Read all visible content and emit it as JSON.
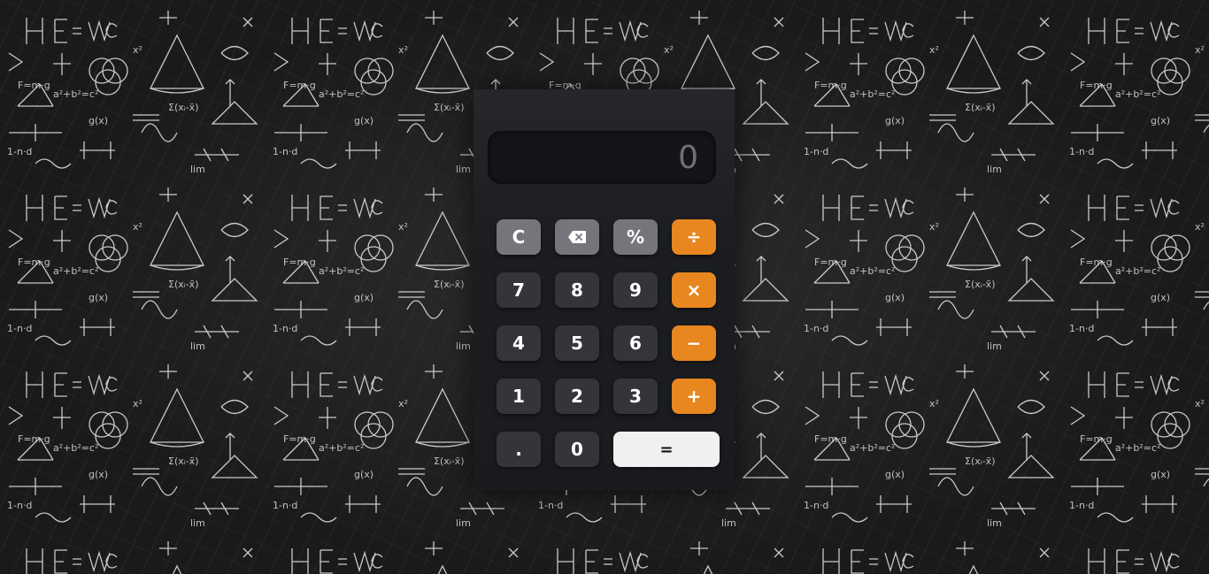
{
  "display": {
    "value": "0"
  },
  "keys": {
    "clear": "C",
    "percent": "%",
    "divide": "÷",
    "seven": "7",
    "eight": "8",
    "nine": "9",
    "multiply": "×",
    "four": "4",
    "five": "5",
    "six": "6",
    "subtract": "−",
    "one": "1",
    "two": "2",
    "three": "3",
    "add": "+",
    "decimal": ".",
    "zero": "0",
    "equals": "="
  },
  "icons": {
    "backspace": "backspace-icon"
  },
  "colors": {
    "operator": "#e8861f",
    "function": "#74767b",
    "digit": "#333539",
    "equals": "#f0f0f0",
    "calculator_body": "#1c1d21",
    "display_bg": "#141518"
  }
}
